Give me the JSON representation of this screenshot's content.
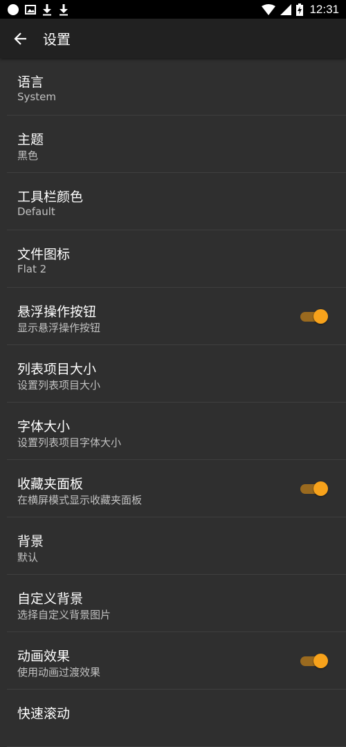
{
  "status_bar": {
    "time": "12:31",
    "left_icons": [
      "notification-dot-icon",
      "image-icon",
      "download-icon",
      "download-icon"
    ],
    "right_icons": [
      "wifi-icon",
      "signal-icon",
      "battery-icon"
    ]
  },
  "app_bar": {
    "title": "设置",
    "back_icon": "arrow-left-icon"
  },
  "colors": {
    "accent": "#f7a21b",
    "toggle_track": "#9a6a1f",
    "background": "#2f2f2f",
    "app_bar": "#212121"
  },
  "settings": [
    {
      "title": "语言",
      "summary": "System"
    },
    {
      "title": "主题",
      "summary": "黑色"
    },
    {
      "title": "工具栏颜色",
      "summary": "Default"
    },
    {
      "title": "文件图标",
      "summary": "Flat 2"
    },
    {
      "title": "悬浮操作按钮",
      "summary": "显示悬浮操作按钮",
      "toggle": true
    },
    {
      "title": "列表项目大小",
      "summary": "设置列表项目大小"
    },
    {
      "title": "字体大小",
      "summary": "设置列表项目字体大小"
    },
    {
      "title": "收藏夹面板",
      "summary": "在横屏模式显示收藏夹面板",
      "toggle": true
    },
    {
      "title": "背景",
      "summary": "默认"
    },
    {
      "title": "自定义背景",
      "summary": "选择自定义背景图片"
    },
    {
      "title": "动画效果",
      "summary": "使用动画过渡效果",
      "toggle": true
    },
    {
      "title": "快速滚动",
      "summary": ""
    }
  ]
}
